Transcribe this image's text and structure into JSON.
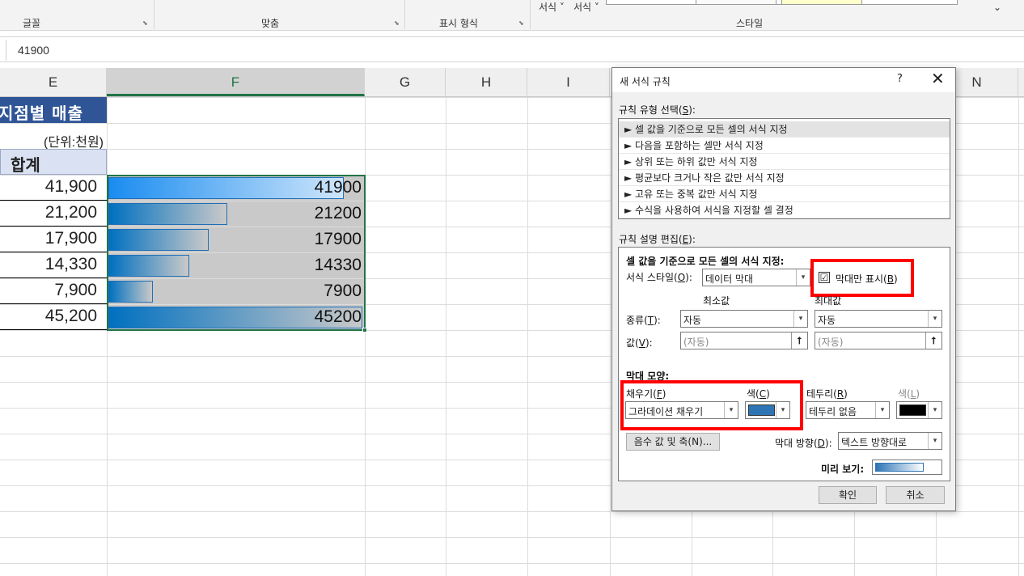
{
  "ribbon": {
    "groups": [
      "글꼴",
      "맞춤",
      "표시 형식",
      "스타일"
    ],
    "style_buttons": [
      "서식",
      "서식"
    ]
  },
  "formula_bar": {
    "value": "41900"
  },
  "columns": [
    "E",
    "F",
    "G",
    "H",
    "I",
    "N"
  ],
  "sheet": {
    "title": "지점별 매출",
    "unit": "(단위:천원)",
    "sum_header": "합계",
    "e_values": [
      "41,900",
      "21,200",
      "17,900",
      "14,330",
      "7,900",
      "45,200"
    ],
    "f_values": [
      "41900",
      "21200",
      "17900",
      "14330",
      "7900",
      "45200"
    ],
    "f_numbers": [
      41900,
      21200,
      17900,
      14330,
      7900,
      45200
    ],
    "bar_color": "#0070c0"
  },
  "dialog": {
    "title": "새 서식 규칙",
    "help": "?",
    "close": "✕",
    "select_rule_label": "규칙 유형 선택(",
    "select_rule_key": "S",
    "select_rule_suffix": "):",
    "rule_types": [
      "► 셀 값을 기준으로 모든 셀의 서식 지정",
      "► 다음을 포함하는 셀만 서식 지정",
      "► 상위 또는 하위 값만 서식 지정",
      "► 평균보다 크거나 작은 값만 서식 지정",
      "► 고유 또는 중복 값만 서식 지정",
      "► 수식을 사용하여 서식을 지정할 셀 결정"
    ],
    "edit_label": "규칙 설명 편집(",
    "edit_key": "E",
    "edit_suffix": "):",
    "section_header": "셀 값을 기준으로 모든 셀의 서식 지정:",
    "format_style_label": "서식 스타일(",
    "format_style_key": "O",
    "format_style_suffix": "):",
    "format_style_value": "데이터 막대",
    "show_bar_only_label": "막대만 표시(",
    "show_bar_only_key": "B",
    "show_bar_only_suffix": ")",
    "show_bar_only_checked": "☑",
    "min_header": "최소값",
    "max_header": "최대값",
    "type_label": "종류(",
    "type_key": "T",
    "type_suffix": "):",
    "min_type": "자동",
    "max_type": "자동",
    "value_label": "값(",
    "value_key": "V",
    "value_suffix": "):",
    "min_value": "(자동)",
    "max_value": "(자동)",
    "bar_shape_header": "막대 모양:",
    "fill_label": "채우기(",
    "fill_key": "F",
    "fill_suffix": ")",
    "fill_value": "그라데이션 채우기",
    "color_label": "색(",
    "color_key": "C",
    "color_suffix": ")",
    "fill_color": "#2e75b6",
    "border_label": "테두리(",
    "border_key": "R",
    "border_suffix": ")",
    "border_value": "테두리 없음",
    "border_color_label": "색(",
    "border_color_key": "L",
    "border_color_suffix": ")",
    "border_color": "#000000",
    "negative_button": "음수 값 및 축(N)...",
    "direction_label": "막대 방향(",
    "direction_key": "D",
    "direction_suffix": "):",
    "direction_value": "텍스트 방향대로",
    "preview_label": "미리 보기:",
    "ok": "확인",
    "cancel": "취소"
  }
}
